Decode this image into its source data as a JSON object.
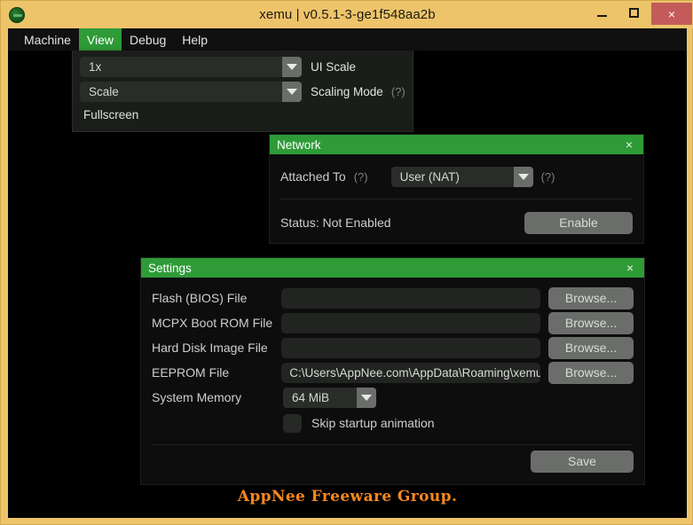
{
  "window": {
    "title": "xemu | v0.5.1-3-ge1f548aa2b",
    "app_icon": "xemu-logo-icon",
    "controls": {
      "minimize": "minimize-icon",
      "maximize": "maximize-icon",
      "close": "×"
    },
    "colors": {
      "titlebar": "#eec46a",
      "close_button": "#c35b5b",
      "accent_green": "#2e9b37",
      "client_background": "#000000"
    }
  },
  "menubar": {
    "items": [
      {
        "label": "Machine",
        "active": false
      },
      {
        "label": "View",
        "active": true
      },
      {
        "label": "Debug",
        "active": false
      },
      {
        "label": "Help",
        "active": false
      }
    ]
  },
  "view_menu": {
    "ui_scale": {
      "value": "1x",
      "caption": "UI Scale"
    },
    "scaling_mode": {
      "value": "Scale",
      "caption": "Scaling Mode",
      "help": "(?)"
    },
    "fullscreen_label": "Fullscreen"
  },
  "network_panel": {
    "title": "Network",
    "close": "×",
    "attached_to_label": "Attached To",
    "attached_to_help": "(?)",
    "attached_to_value": "User (NAT)",
    "attached_to_trailing_help": "(?)",
    "status_text": "Status: Not Enabled",
    "enable_button": "Enable"
  },
  "settings_panel": {
    "title": "Settings",
    "close": "×",
    "rows": [
      {
        "label": "Flash (BIOS) File",
        "value": "",
        "button": "Browse..."
      },
      {
        "label": "MCPX Boot ROM File",
        "value": "",
        "button": "Browse..."
      },
      {
        "label": "Hard Disk Image File",
        "value": "",
        "button": "Browse..."
      },
      {
        "label": "EEPROM File",
        "value": "C:\\Users\\AppNee.com\\AppData\\Roaming\\xemu",
        "button": "Browse..."
      }
    ],
    "system_memory_label": "System Memory",
    "system_memory_value": "64 MiB",
    "skip_animation_label": "Skip startup animation",
    "skip_animation_checked": false,
    "save_button": "Save"
  },
  "watermark": "AppNee Freeware Group."
}
